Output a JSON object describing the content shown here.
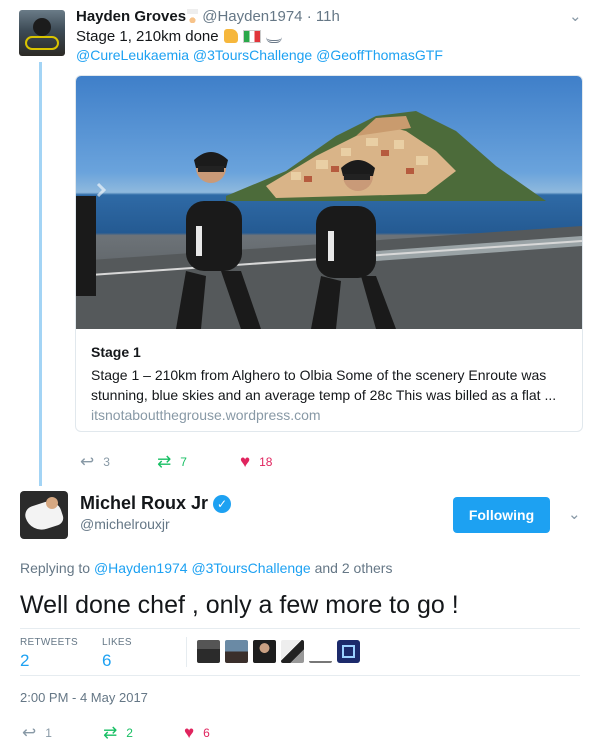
{
  "tweet1": {
    "name": "Hayden Groves",
    "handle": "@Hayden1974",
    "time": "11h",
    "text": "Stage 1, 210km done",
    "mentions": "@CureLeukaemia @3ToursChallenge @GeoffThomasGTF",
    "card": {
      "title": "Stage 1",
      "description": "Stage 1 – 210km from Alghero to Olbia Some of the scenery Enroute was stunning, blue skies and an average temp of 28c This was billed as a flat ...",
      "domain": "itsnotaboutthegrouse.wordpress.com"
    },
    "actions": {
      "replies": "3",
      "retweets": "7",
      "likes": "18"
    },
    "icons": {
      "reply": "reply-icon",
      "retweet": "retweet-icon",
      "like": "heart-icon",
      "menu": "chevron-down-icon"
    }
  },
  "tweet2": {
    "name": "Michel Roux Jr",
    "handle": "@michelrouxjr",
    "follow_label": "Following",
    "replying_prefix": "Replying to",
    "replying_users": "@Hayden1974 @3ToursChallenge",
    "replying_suffix": "and 2 others",
    "text": "Well done chef , only a few more to go !",
    "stats": {
      "retweets_label": "RETWEETS",
      "retweets": "2",
      "likes_label": "LIKES",
      "likes": "6"
    },
    "timestamp": "2:00 PM - 4 May 2017",
    "actions": {
      "replies": "1",
      "retweets": "2",
      "likes": "6"
    }
  },
  "colors": {
    "accent": "#1da1f2",
    "retweet": "#17bf63",
    "like": "#e0245e",
    "muted": "#657786",
    "thread": "#a3d4f5"
  }
}
